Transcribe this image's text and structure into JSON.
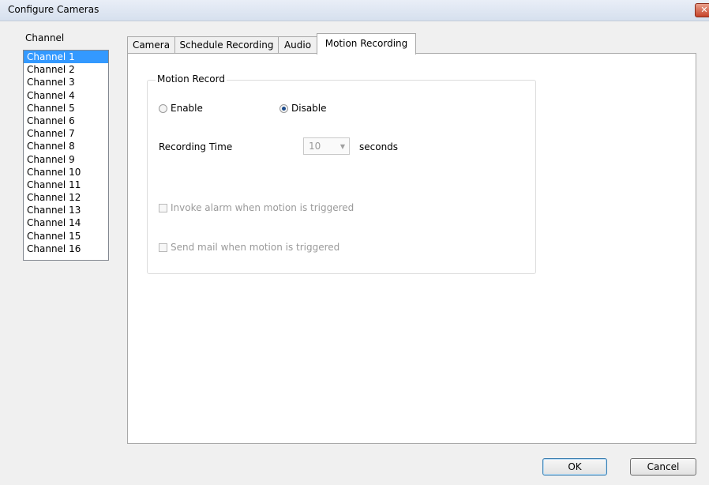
{
  "window": {
    "title": "Configure Cameras",
    "close_label": "✕"
  },
  "sidebar": {
    "label": "Channel",
    "channels": [
      "Channel 1",
      "Channel 2",
      "Channel 3",
      "Channel 4",
      "Channel 5",
      "Channel 6",
      "Channel 7",
      "Channel 8",
      "Channel 9",
      "Channel 10",
      "Channel 11",
      "Channel 12",
      "Channel 13",
      "Channel 14",
      "Channel 15",
      "Channel 16"
    ],
    "selected_index": 0
  },
  "tabs": [
    "Camera",
    "Schedule Recording",
    "Audio",
    "Motion Recording"
  ],
  "active_tab": "Motion Recording",
  "motion": {
    "group_label": "Motion Record",
    "enable_label": "Enable",
    "disable_label": "Disable",
    "selected": "Disable",
    "recording_time_label": "Recording Time",
    "recording_time_value": "10",
    "seconds_label": "seconds",
    "invoke_alarm_label": "Invoke alarm when motion is triggered",
    "send_mail_label": "Send mail when motion is triggered"
  },
  "buttons": {
    "ok": "OK",
    "cancel": "Cancel"
  }
}
